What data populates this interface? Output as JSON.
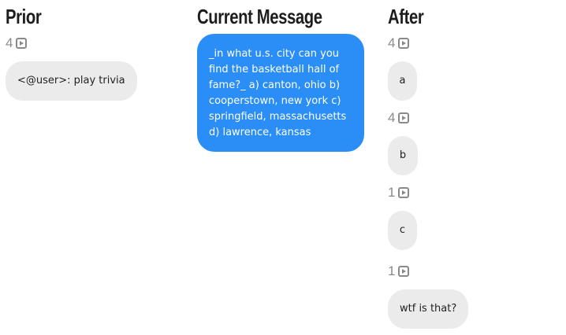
{
  "columns": {
    "prior": {
      "title": "Prior",
      "count": "4",
      "message": "<@user>: play trivia"
    },
    "current": {
      "title": "Current Message",
      "message": "_in what u.s. city can you find the basketball hall of fame?_ a) canton, ohio b) cooperstown, new york c) springfield, massachusetts d) lawrence, kansas"
    },
    "after": {
      "title": "After",
      "items": [
        {
          "count": "4",
          "message": "a"
        },
        {
          "count": "4",
          "message": "b"
        },
        {
          "count": "1",
          "message": "c"
        },
        {
          "count": "1",
          "message": "wtf is that?"
        }
      ]
    }
  },
  "icons": {
    "count_icon": "play-icon"
  },
  "colors": {
    "current_bubble": "#2b8ef6",
    "reply_bubble": "#ebebeb",
    "count_text": "#8a8a8a"
  }
}
